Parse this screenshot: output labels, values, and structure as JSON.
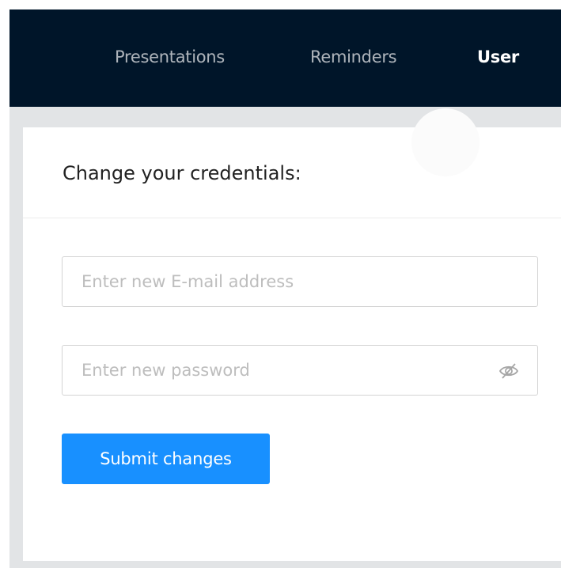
{
  "nav": {
    "items": [
      {
        "label": "Presentations",
        "active": false
      },
      {
        "label": "Reminders",
        "active": false
      },
      {
        "label": "User",
        "active": true
      }
    ]
  },
  "credentials_card": {
    "title": "Change your credentials:",
    "email_field": {
      "value": "",
      "placeholder": "Enter new E-mail address"
    },
    "password_field": {
      "value": "",
      "placeholder": "Enter new password",
      "visibility_icon": "eye-invisible-icon"
    },
    "submit_label": "Submit changes"
  },
  "colors": {
    "navbar_bg": "#001529",
    "page_bg": "#e2e4e6",
    "primary": "#1890ff",
    "nav_inactive_text": "rgba(255,255,255,0.68)",
    "nav_active_text": "#ffffff"
  }
}
